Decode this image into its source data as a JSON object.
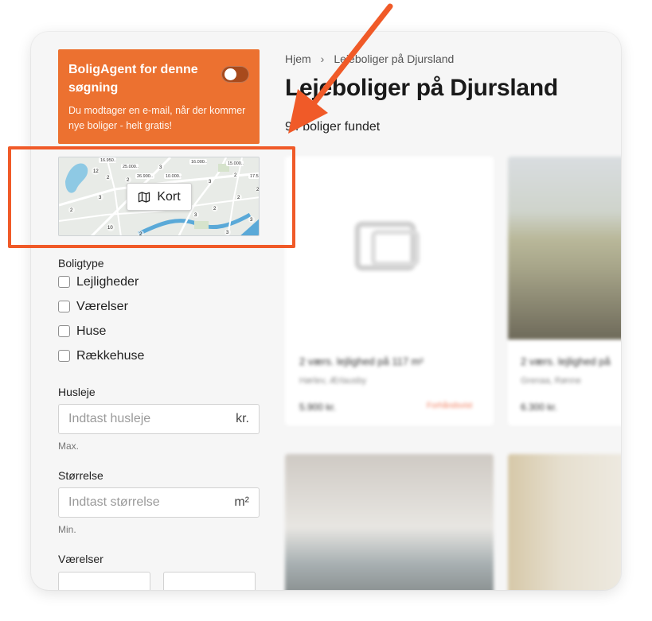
{
  "agent": {
    "title": "BoligAgent for denne søgning",
    "description": "Du modtager en e-mail, når der kommer nye boliger - helt gratis!",
    "toggle_on": false
  },
  "map": {
    "button_label": "Kort",
    "icon": "map-icon",
    "price_labels": [
      "16.950..",
      "25.000..",
      "26.900..",
      "10.000..",
      "16.000..",
      "15.000..",
      "17.5"
    ],
    "count_labels": [
      "12",
      "2",
      "2",
      "3",
      "3",
      "2",
      "2",
      "3",
      "2",
      "10",
      "2",
      "3",
      "2",
      "3",
      "3",
      "2"
    ]
  },
  "filters": {
    "boligtype_label": "Boligtype",
    "boligtype_options": [
      {
        "label": "Lejligheder",
        "checked": false
      },
      {
        "label": "Værelser",
        "checked": false
      },
      {
        "label": "Huse",
        "checked": false
      },
      {
        "label": "Rækkehuse",
        "checked": false
      }
    ],
    "husleje": {
      "label": "Husleje",
      "placeholder": "Indtast husleje",
      "unit": "kr.",
      "hint": "Max."
    },
    "storrelse": {
      "label": "Størrelse",
      "placeholder": "Indtast størrelse",
      "unit": "m²",
      "hint": "Min."
    },
    "vaerelser": {
      "label": "Værelser"
    }
  },
  "header": {
    "breadcrumb": [
      {
        "label": "Hjem"
      },
      {
        "label": "Lejeboliger på Djursland"
      }
    ],
    "title": "Lejeboliger på Djursland",
    "result_count": "94 boliger fundet"
  },
  "listings": [
    {
      "title": "2 værs. lejlighed på 117 m²",
      "location": "Hørlev, Ærlausby",
      "price": "5.900 kr.",
      "badge": "Forhåndsvist"
    },
    {
      "title": "2 værs. lejlighed på",
      "location": "Grenaa, Rønne",
      "price": "6.300 kr."
    }
  ],
  "colors": {
    "accent": "#ec7130",
    "annotation": "#f05a28"
  }
}
